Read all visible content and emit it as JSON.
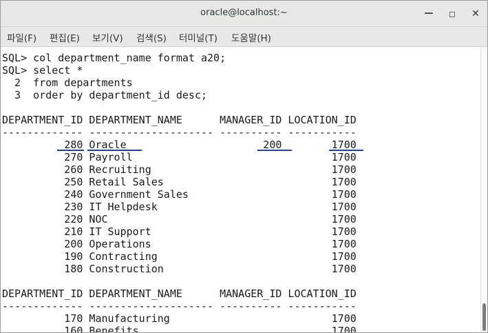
{
  "window": {
    "title": "oracle@localhost:~"
  },
  "menu": [
    "파일(F)",
    "편집(E)",
    "보기(V)",
    "검색(S)",
    "터미널(T)",
    "도움말(H)"
  ],
  "terminal": {
    "lines": [
      "SQL> col department_name format a20;",
      "SQL> select *",
      "  2  from departments",
      "  3  order by department_id desc;",
      "",
      "DEPARTMENT_ID DEPARTMENT_NAME      MANAGER_ID LOCATION_ID",
      "------------- -------------------- ---------- -----------",
      "          280 Oracle                      200        1700",
      "          270 Payroll                                1700",
      "          260 Recruiting                             1700",
      "          250 Retail Sales                           1700",
      "          240 Government Sales                       1700",
      "          230 IT Helpdesk                            1700",
      "          220 NOC                                    1700",
      "          210 IT Support                             1700",
      "          200 Operations                             1700",
      "          190 Contracting                            1700",
      "          180 Construction                           1700",
      "",
      "DEPARTMENT_ID DEPARTMENT_NAME      MANAGER_ID LOCATION_ID",
      "------------- -------------------- ---------- -----------",
      "          170 Manufacturing                          1700",
      "          160 Benefits                               1700"
    ]
  },
  "annotation": {
    "color": "#1a3cc4"
  }
}
